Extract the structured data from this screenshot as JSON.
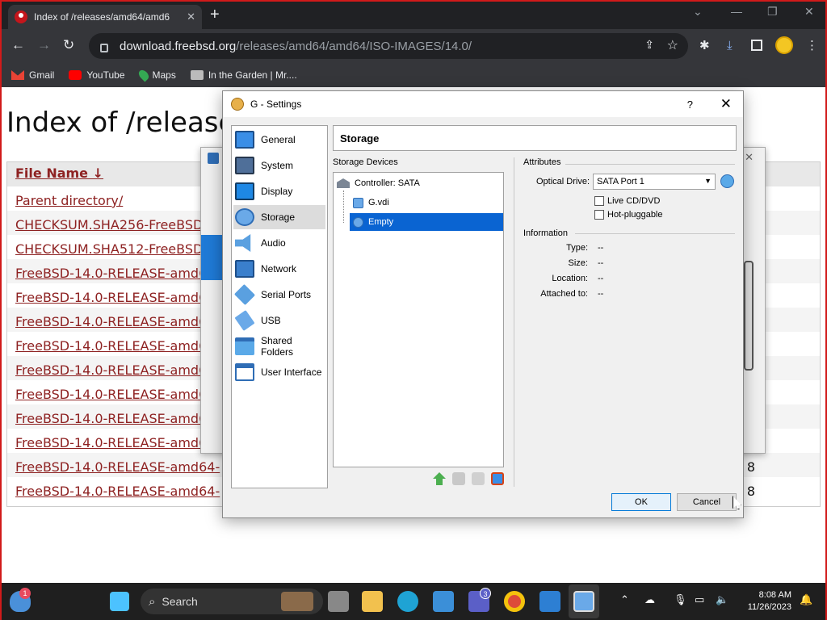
{
  "browser": {
    "tab_title": "Index of /releases/amd64/amd6",
    "url_host": "download.freebsd.org",
    "url_path": "/releases/amd64/amd64/ISO-IMAGES/14.0/",
    "bookmarks": [
      "Gmail",
      "YouTube",
      "Maps",
      "In the Garden | Mr...."
    ]
  },
  "page": {
    "heading": "Index of /release",
    "column_header": "File Name  ↓",
    "rows": [
      "Parent directory/",
      "CHECKSUM.SHA256-FreeBSD-",
      "CHECKSUM.SHA512-FreeBSD-",
      "FreeBSD-14.0-RELEASE-amd6",
      "FreeBSD-14.0-RELEASE-amd6",
      "FreeBSD-14.0-RELEASE-amd6",
      "FreeBSD-14.0-RELEASE-amd6",
      "FreeBSD-14.0-RELEASE-amd6",
      "FreeBSD-14.0-RELEASE-amd6",
      "FreeBSD-14.0-RELEASE-amd6",
      "FreeBSD-14.0-RELEASE-amd6",
      "FreeBSD-14.0-RELEASE-amd64-",
      "FreeBSD-14.0-RELEASE-amd64-"
    ],
    "size_fragments": [
      "8",
      "8"
    ]
  },
  "dialog": {
    "title": "G - Settings",
    "help": "?",
    "close": "✕",
    "nav": [
      "General",
      "System",
      "Display",
      "Storage",
      "Audio",
      "Network",
      "Serial Ports",
      "USB",
      "Shared Folders",
      "User Interface"
    ],
    "selected_nav": "Storage",
    "section_header": "Storage",
    "storage_devices_label": "Storage Devices",
    "tree": {
      "controller": "Controller: SATA",
      "disk": "G.vdi",
      "optical": "Empty"
    },
    "attributes_label": "Attributes",
    "optical_drive_label": "Optical Drive:",
    "optical_drive_value": "SATA Port 1",
    "live_cd": "Live CD/DVD",
    "hot_pluggable": "Hot-pluggable",
    "information_label": "Information",
    "info": [
      {
        "label": "Type:",
        "value": "--"
      },
      {
        "label": "Size:",
        "value": "--"
      },
      {
        "label": "Location:",
        "value": "--"
      },
      {
        "label": "Attached to:",
        "value": "--"
      }
    ],
    "ok": "OK",
    "cancel": "Cancel"
  },
  "taskbar": {
    "search": "Search",
    "time": "8:08 AM",
    "date": "11/26/2023",
    "weather_badge": "1",
    "teams_badge": "3"
  }
}
